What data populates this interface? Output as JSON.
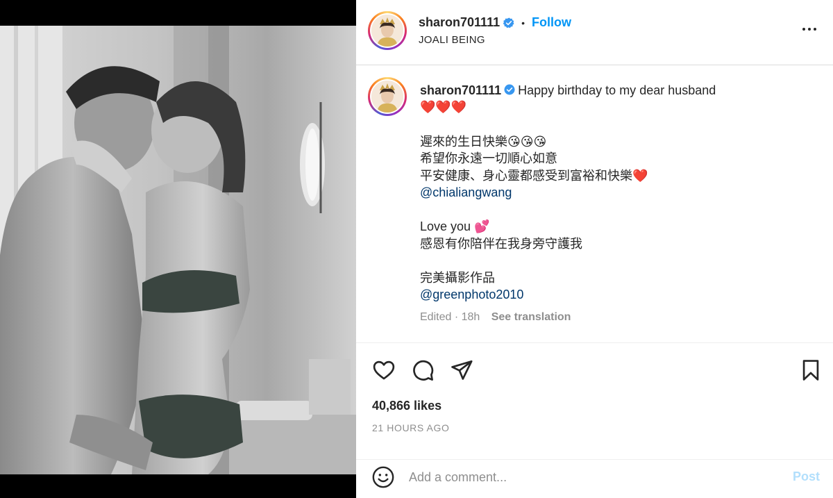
{
  "post": {
    "author": {
      "username": "sharon701111",
      "verified": true,
      "avatar": "profile-photo"
    },
    "follow_label": "Follow",
    "separator": "•",
    "location": "JOALI BEING",
    "caption": {
      "lines": [
        "Happy birthday to my dear husband",
        "❤️❤️❤️",
        "",
        "遲來的生日快樂😘😘😘",
        "希望你永遠一切順心如意",
        "平安健康、身心靈都感受到富裕和快樂❤️",
        "@chialiangwang",
        "",
        "Love you 💕",
        "感恩有你陪伴在我身旁守護我",
        "",
        "完美攝影作品",
        "@greenphoto2010"
      ],
      "edited_label": "Edited · 18h",
      "see_translation": "See translation"
    },
    "likes": "40,866 likes",
    "timestamp": "21 HOURS AGO"
  },
  "comment": {
    "placeholder": "Add a comment...",
    "post_label": "Post"
  },
  "icons": {
    "more": "more-options-icon",
    "like": "heart-icon",
    "comment": "comment-icon",
    "share": "share-icon",
    "save": "bookmark-icon",
    "emoji": "emoji-icon",
    "verified": "verified-badge-icon"
  },
  "colors": {
    "follow": "#0095f6",
    "mention": "#00376b",
    "post_disabled": "#b2dffc",
    "secondary_text": "#8e8e8e",
    "verified": "#3897f0"
  }
}
